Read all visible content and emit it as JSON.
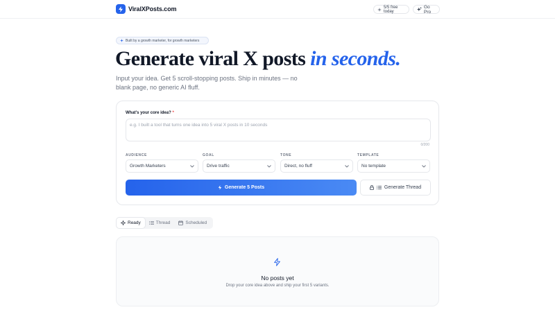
{
  "header": {
    "brand": "ViralXPosts.com",
    "free_pill": "5/5 free today",
    "pro_label": "Go Pro"
  },
  "hero": {
    "tag": "Built by a growth marketer, for growth marketers",
    "headline_main": "Generate viral X posts ",
    "headline_accent": "in seconds.",
    "subhead": "Input your idea. Get 5 scroll-stopping posts. Ship in minutes — no blank page, no generic AI fluff."
  },
  "form": {
    "idea_label": "What's your core idea?",
    "required_mark": "*",
    "idea_placeholder": "e.g. I built a tool that turns one idea into 5 viral X posts in 10 seconds",
    "counter": "0/200",
    "fields": [
      {
        "label": "AUDIENCE",
        "value": "Growth Marketers"
      },
      {
        "label": "GOAL",
        "value": "Drive traffic"
      },
      {
        "label": "TONE",
        "value": "Direct, no fluff"
      },
      {
        "label": "TEMPLATE",
        "value": "No template"
      }
    ],
    "generate_label": "Generate 5 Posts",
    "thread_label": "Generate Thread"
  },
  "tabs": [
    {
      "label": "Ready",
      "icon": "sparkle-icon",
      "active": true
    },
    {
      "label": "Thread",
      "icon": "list-icon",
      "active": false
    },
    {
      "label": "Scheduled",
      "icon": "calendar-icon",
      "active": false
    }
  ],
  "empty_state": {
    "title": "No posts yet",
    "subtitle": "Drop your core idea above and ship your first 5 variants."
  },
  "colors": {
    "accent": "#2563eb",
    "accent_light": "#4a8af4",
    "required": "#ef4444"
  }
}
